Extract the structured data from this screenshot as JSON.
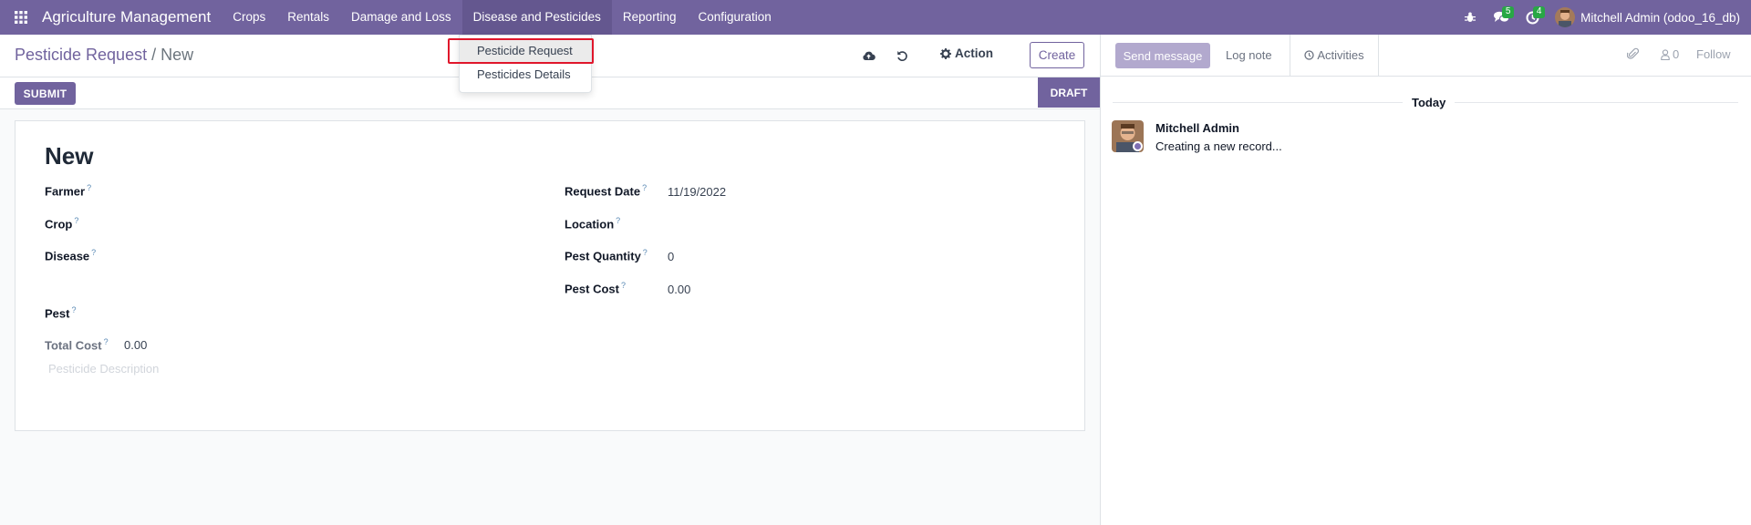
{
  "navbar": {
    "brand": "Agriculture Management",
    "menu": [
      "Crops",
      "Rentals",
      "Damage and Loss",
      "Disease and Pesticides",
      "Reporting",
      "Configuration"
    ],
    "messages_count": "5",
    "activities_count": "4",
    "user": "Mitchell Admin (odoo_16_db)",
    "color": "#71639e"
  },
  "dropdown": {
    "items": [
      "Pesticide Request",
      "Pesticides Details"
    ]
  },
  "control_panel": {
    "breadcrumb_parent": "Pesticide Request",
    "breadcrumb_sep": "/",
    "breadcrumb_current": "New",
    "action_label": "Action",
    "create_label": "Create"
  },
  "statusbar": {
    "submit_label": "SUBMIT",
    "state_label": "DRAFT"
  },
  "form": {
    "title": "New",
    "left_fields": [
      {
        "label": "Farmer",
        "value": ""
      },
      {
        "label": "Crop",
        "value": ""
      },
      {
        "label": "Disease",
        "value": ""
      },
      {
        "label": "Pest",
        "value": ""
      }
    ],
    "right_fields": [
      {
        "label": "Request Date",
        "value": "11/19/2022"
      },
      {
        "label": "Location",
        "value": ""
      },
      {
        "label": "Pest Quantity",
        "value": "0"
      },
      {
        "label": "Pest Cost",
        "value": "0.00"
      }
    ],
    "total_cost": {
      "label": "Total Cost",
      "value": "0.00"
    },
    "description_placeholder": "Pesticide Description",
    "help_mark": "?"
  },
  "chatter": {
    "send_message": "Send message",
    "log_note": "Log note",
    "activities": "Activities",
    "followers_count": "0",
    "follow": "Follow",
    "day_label": "Today",
    "message": {
      "author": "Mitchell Admin",
      "body": "Creating a new record..."
    }
  }
}
